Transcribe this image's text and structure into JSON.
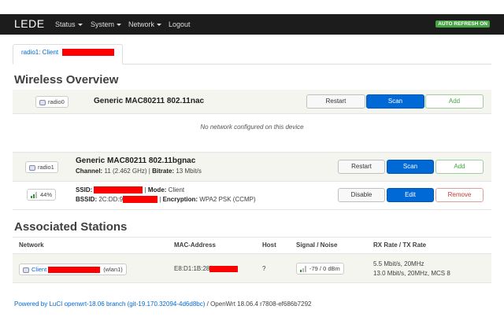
{
  "navbar": {
    "brand": "LEDE",
    "menu": [
      "Status",
      "System",
      "Network",
      "Logout"
    ],
    "auto_refresh": "AUTO REFRESH ON"
  },
  "tab": {
    "label": "radio1: Client"
  },
  "wireless_overview": {
    "title": "Wireless Overview",
    "radio0": {
      "badge": "radio0",
      "name": "Generic MAC80211 802.11nac",
      "empty_text": "No network configured on this device",
      "buttons": {
        "restart": "Restart",
        "scan": "Scan",
        "add": "Add"
      }
    },
    "radio1": {
      "badge": "radio1",
      "name": "Generic MAC80211 802.11bgnac",
      "channel_label": "Channel:",
      "channel_value": "11 (2.462 GHz)",
      "bitrate_label": "Bitrate:",
      "bitrate_value": "13 Mbit/s",
      "buttons": {
        "restart": "Restart",
        "scan": "Scan",
        "add": "Add"
      }
    },
    "network": {
      "signal": "44%",
      "ssid_label": "SSID:",
      "mode_label": "Mode:",
      "mode_value": "Client",
      "bssid_label": "BSSID:",
      "bssid_value": "2C:DD:9",
      "encryption_label": "Encryption:",
      "encryption_value": "WPA2 PSK (CCMP)",
      "buttons": {
        "disable": "Disable",
        "edit": "Edit",
        "remove": "Remove"
      }
    }
  },
  "stations": {
    "title": "Associated Stations",
    "headers": [
      "Network",
      "MAC-Address",
      "Host",
      "Signal / Noise",
      "RX Rate / TX Rate"
    ],
    "row": {
      "network": "Client",
      "iface": "(wlan1)",
      "mac": "E8:D1:1B:28",
      "host": "?",
      "signal": "-79 / 0 dBm",
      "rx": "5.5 Mbit/s, 20MHz",
      "tx": "13.0 Mbit/s, 20MHz, MCS 8"
    }
  },
  "footer": {
    "link": "Powered by LuCI openwrt-18.06 branch (git-19.170.32094-4d6d8bc)",
    "rest": "/ OpenWrt 18.06.4 r7808-ef686b7292"
  },
  "colors": {
    "navbar": "#1c1c1c",
    "accent": "#0069d6",
    "add": "#46a546",
    "remove": "#c43c35",
    "redaction": "#ff0000"
  }
}
